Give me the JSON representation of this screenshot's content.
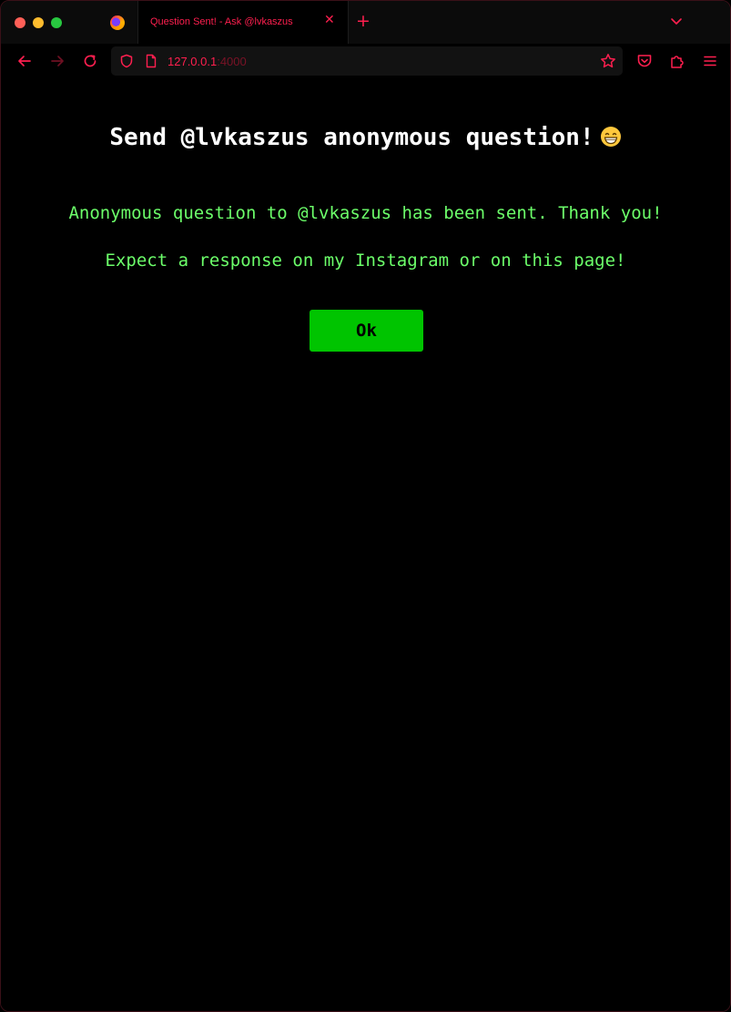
{
  "browser": {
    "tab": {
      "title": "Question Sent! - Ask @lvkaszus",
      "close_label": "✕"
    },
    "new_tab_label": "+",
    "url": {
      "host": "127.0.0.1",
      "port": ":4000"
    },
    "accent_color": "#ff1f4f",
    "icons": [
      "firefox-icon",
      "back-icon",
      "forward-icon",
      "reload-icon",
      "shield-icon",
      "page-icon",
      "bookmark-star-icon",
      "pocket-icon",
      "extensions-icon",
      "menu-icon",
      "tab-list-chevron-icon"
    ]
  },
  "page": {
    "heading": "Send @lvkaszus anonymous question!",
    "heading_emoji": "grinning-face-emoji",
    "message_sent": "Anonymous question to @lvkaszus has been sent. Thank you!",
    "message_expect": "Expect a response on my Instagram or on this page!",
    "ok_button_label": "Ok",
    "text_color": "#6cff6a",
    "button_color": "#00c400"
  }
}
